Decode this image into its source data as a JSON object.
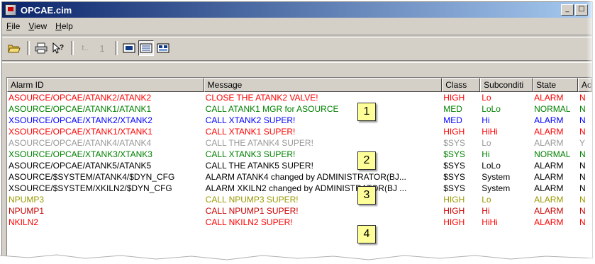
{
  "window": {
    "title": "OPCAE.cim",
    "min_label": "_",
    "max_label": "□"
  },
  "menu": [
    {
      "label": "File",
      "mnemonic": "F",
      "rest": "ile"
    },
    {
      "label": "View",
      "mnemonic": "V",
      "rest": "iew"
    },
    {
      "label": "Help",
      "mnemonic": "H",
      "rest": "elp"
    }
  ],
  "toolbar": {
    "icons": [
      "open-folder-icon",
      "print-icon",
      "context-help-icon",
      "previous-icon",
      "next-icon",
      "view-large-icon",
      "view-details-icon",
      "view-properties-icon"
    ],
    "counter_label": "1",
    "prev_label": "t.."
  },
  "columns": [
    "Alarm ID",
    "Message",
    "Class",
    "Subconditi",
    "State",
    "Ac"
  ],
  "rows": [
    {
      "id": "ASOURCE/OPCAE/ATANK2/ATANK2",
      "msg": "CLOSE THE ATANK2 VALVE!",
      "cls": "HIGH",
      "sub": "Lo",
      "state": "ALARM",
      "ack": "N",
      "color": "#ff0000"
    },
    {
      "id": "ASOURCE/OPCAE/ATANK1/ATANK1",
      "msg": "CALL ATANK1 MGR for ASOURCE",
      "cls": "MED",
      "sub": "LoLo",
      "state": "NORMAL",
      "ack": "N",
      "color": "#008000"
    },
    {
      "id": "XSOURCE/OPCAE/XTANK2/XTANK2",
      "msg": "CALL XTANK2 SUPER!",
      "cls": "MED",
      "sub": "Hi",
      "state": "ALARM",
      "ack": "N",
      "color": "#0000ff"
    },
    {
      "id": "XSOURCE/OPCAE/XTANK1/XTANK1",
      "msg": "CALL XTANK1 SUPER!",
      "cls": "HIGH",
      "sub": "HiHi",
      "state": "ALARM",
      "ack": "N",
      "color": "#ff0000"
    },
    {
      "id": "ASOURCE/OPCAE/ATANK4/ATANK4",
      "msg": "CALL THE ATANK4 SUPER!",
      "cls": "$SYS",
      "sub": "Lo",
      "state": "ALARM",
      "ack": "Y",
      "color": "#999999"
    },
    {
      "id": "XSOURCE/OPCAE/XTANK3/XTANK3",
      "msg": "CALL XTANK3 SUPER!",
      "cls": "$SYS",
      "sub": "Hi",
      "state": "NORMAL",
      "ack": "N",
      "color": "#008000"
    },
    {
      "id": "ASOURCE/OPCAE/ATANK5/ATANK5",
      "msg": "CALL THE ATANK5 SUPER!",
      "cls": "$SYS",
      "sub": "LoLo",
      "state": "ALARM",
      "ack": "N",
      "color": "#000000"
    },
    {
      "id": "ASOURCE/$SYSTEM/ATANK4/$DYN_CFG",
      "msg": "ALARM ATANK4 changed by ADMINISTRATOR(BJ...",
      "cls": "$SYS",
      "sub": "System",
      "state": "ALARM",
      "ack": "N",
      "color": "#000000"
    },
    {
      "id": "XSOURCE/$SYSTEM/XKILN2/$DYN_CFG",
      "msg": "ALARM XKILN2 changed by ADMINISTRATOR(BJ ...",
      "cls": "$SYS",
      "sub": "System",
      "state": "ALARM",
      "ack": "N",
      "color": "#000000"
    },
    {
      "id": "NPUMP3",
      "msg": "CALL NPUMP3 SUPER!",
      "cls": "HIGH",
      "sub": "Lo",
      "state": "ALARM",
      "ack": "N",
      "color": "#999900"
    },
    {
      "id": "NPUMP1",
      "msg": "CALL NPUMP1 SUPER!",
      "cls": "HIGH",
      "sub": "Hi",
      "state": "ALARM",
      "ack": "N",
      "color": "#cc0000"
    },
    {
      "id": "NKILN2",
      "msg": "CALL NKILN2 SUPER!",
      "cls": "HIGH",
      "sub": "HiHi",
      "state": "ALARM",
      "ack": "N",
      "color": "#ff0000"
    }
  ],
  "callouts": [
    "1",
    "2",
    "3",
    "4"
  ]
}
